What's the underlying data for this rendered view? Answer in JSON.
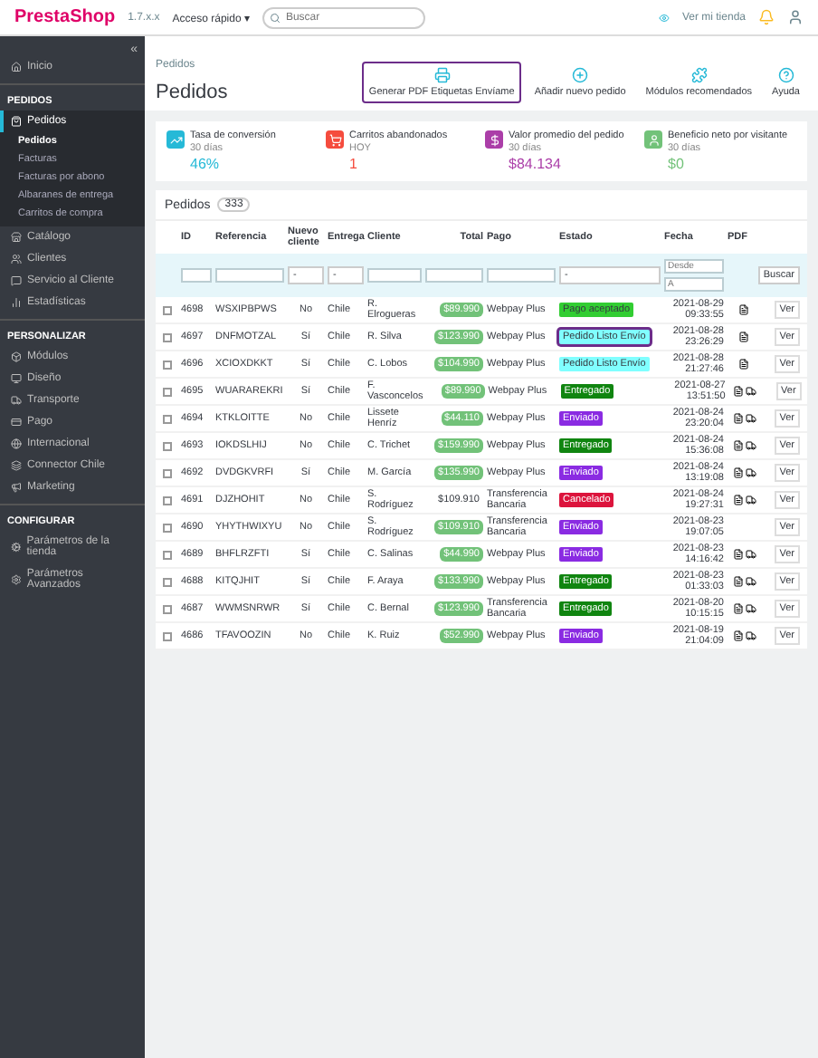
{
  "header": {
    "logo": "PrestaShop",
    "version": "1.7.x.x",
    "quick_access": "Acceso rápido ▾",
    "search": {
      "placeholder": "Buscar"
    },
    "store_link": "Ver mi tienda"
  },
  "sidebar": {
    "collapse": "«",
    "items": [
      {
        "label": "Inicio",
        "kind": "item",
        "selected": false
      },
      {
        "label": "PEDIDOS",
        "kind": "section"
      },
      {
        "label": "Pedidos",
        "kind": "item",
        "selected": true,
        "expanded": true,
        "children": [
          {
            "label": "Pedidos",
            "selected": true
          },
          {
            "label": "Facturas",
            "selected": false
          },
          {
            "label": "Facturas por abono",
            "selected": false
          },
          {
            "label": "Albaranes de entrega",
            "selected": false
          },
          {
            "label": "Carritos de compra",
            "selected": false
          }
        ]
      },
      {
        "label": "Catálogo",
        "kind": "item",
        "selected": false
      },
      {
        "label": "Clientes",
        "kind": "item",
        "selected": false
      },
      {
        "label": "Servicio al Cliente",
        "kind": "item",
        "selected": false
      },
      {
        "label": "Estadísticas",
        "kind": "item",
        "selected": false
      },
      {
        "label": "PERSONALIZAR",
        "kind": "section"
      },
      {
        "label": "Módulos",
        "kind": "item",
        "selected": false
      },
      {
        "label": "Diseño",
        "kind": "item",
        "selected": false
      },
      {
        "label": "Transporte",
        "kind": "item",
        "selected": false
      },
      {
        "label": "Pago",
        "kind": "item",
        "selected": false
      },
      {
        "label": "Internacional",
        "kind": "item",
        "selected": false
      },
      {
        "label": "Connector Chile",
        "kind": "item",
        "selected": false
      },
      {
        "label": "Marketing",
        "kind": "item",
        "selected": false
      },
      {
        "label": "CONFIGURAR",
        "kind": "section"
      },
      {
        "label": "Parámetros de la tienda",
        "kind": "item",
        "selected": false
      },
      {
        "label": "Parámetros Avanzados",
        "kind": "item",
        "selected": false
      }
    ]
  },
  "toolbar": {
    "breadcrumb": "Pedidos",
    "title": "Pedidos",
    "buttons": [
      {
        "label": "Generar PDF Etiquetas Envíame",
        "kind": "print",
        "highlighted": true
      },
      {
        "label": "Añadir nuevo pedido",
        "kind": "add",
        "highlighted": false
      },
      {
        "label": "Módulos recomendados",
        "kind": "puzzle",
        "highlighted": false
      },
      {
        "label": "Ayuda",
        "kind": "help",
        "highlighted": false
      }
    ]
  },
  "kpis": [
    {
      "title": "Tasa de conversión",
      "period": "30 días",
      "value": "46%",
      "kind": "conversion",
      "color": "#25b9d7"
    },
    {
      "title": "Carritos abandonados",
      "period": "HOY",
      "value": "1",
      "kind": "cart",
      "color": "#f54c3e"
    },
    {
      "title": "Valor promedio del pedido",
      "period": "30 días",
      "value": "$84.134",
      "kind": "money",
      "color": "#ab3ea8"
    },
    {
      "title": "Beneficio neto por visitante",
      "period": "30 días",
      "value": "$0",
      "kind": "user",
      "color": "#72c279"
    }
  ],
  "table": {
    "title": "Pedidos",
    "count": "333",
    "columns": [
      "ID",
      "Referencia",
      "Nuevo cliente",
      "Entrega",
      "Cliente",
      "Total",
      "Pago",
      "Estado",
      "Fecha",
      "PDF"
    ],
    "filters": {
      "date_from": {
        "placeholder": "Desde"
      },
      "date_to": {
        "placeholder": "A"
      },
      "search_button": "Buscar",
      "selects": [
        "-",
        "-",
        "-"
      ]
    },
    "rows": [
      {
        "id": "4698",
        "ref": "WSXIPBPWS",
        "new": "No",
        "delivery": "Chile",
        "customer": "R. Elrogueras",
        "total": "$89.990",
        "total_paid": true,
        "payment": "Webpay Plus",
        "status": "Pago aceptado",
        "color": "#32cd32",
        "selected": false,
        "date": "2021-08-29 09:33:55",
        "invoice": true,
        "delivery_slip": false,
        "checked": false,
        "view": "Ver"
      },
      {
        "id": "4697",
        "ref": "DNFMOTZAL",
        "new": "Sí",
        "delivery": "Chile",
        "customer": "R. Silva",
        "total": "$123.990",
        "total_paid": true,
        "payment": "Webpay Plus",
        "status": "Pedido Listo Envío",
        "color": "#80ffff",
        "selected": true,
        "date": "2021-08-28 23:26:29",
        "invoice": true,
        "delivery_slip": false,
        "checked": false,
        "view": "Ver"
      },
      {
        "id": "4696",
        "ref": "XCIOXDKKT",
        "new": "Sí",
        "delivery": "Chile",
        "customer": "C. Lobos",
        "total": "$104.990",
        "total_paid": true,
        "payment": "Webpay Plus",
        "status": "Pedido Listo Envío",
        "color": "#80ffff",
        "selected": false,
        "date": "2021-08-28 21:27:46",
        "invoice": true,
        "delivery_slip": false,
        "checked": false,
        "view": "Ver"
      },
      {
        "id": "4695",
        "ref": "WUARAREKRI",
        "new": "Sí",
        "delivery": "Chile",
        "customer": "F. Vasconcelos",
        "total": "$89.990",
        "total_paid": true,
        "payment": "Webpay Plus",
        "status": "Entregado",
        "color": "#108510",
        "selected": false,
        "date": "2021-08-27 13:51:50",
        "invoice": true,
        "delivery_slip": true,
        "checked": false,
        "view": "Ver"
      },
      {
        "id": "4694",
        "ref": "KTKLOITTE",
        "new": "No",
        "delivery": "Chile",
        "customer": "Lissete Henríz",
        "total": "$44.110",
        "total_paid": true,
        "payment": "Webpay Plus",
        "status": "Enviado",
        "color": "#8a2be2",
        "selected": false,
        "date": "2021-08-24 23:20:04",
        "invoice": true,
        "delivery_slip": true,
        "checked": false,
        "view": "Ver"
      },
      {
        "id": "4693",
        "ref": "IOKDSLHIJ",
        "new": "No",
        "delivery": "Chile",
        "customer": "C. Trichet",
        "total": "$159.990",
        "total_paid": true,
        "payment": "Webpay Plus",
        "status": "Entregado",
        "color": "#108510",
        "selected": false,
        "date": "2021-08-24 15:36:08",
        "invoice": true,
        "delivery_slip": true,
        "checked": false,
        "view": "Ver"
      },
      {
        "id": "4692",
        "ref": "DVDGKVRFI",
        "new": "Sí",
        "delivery": "Chile",
        "customer": "M. García",
        "total": "$135.990",
        "total_paid": true,
        "payment": "Webpay Plus",
        "status": "Enviado",
        "color": "#8a2be2",
        "selected": false,
        "date": "2021-08-24 13:19:08",
        "invoice": true,
        "delivery_slip": true,
        "checked": false,
        "view": "Ver"
      },
      {
        "id": "4691",
        "ref": "DJZHOHIT",
        "new": "No",
        "delivery": "Chile",
        "customer": "S. Rodríguez",
        "total": "$109.910",
        "total_paid": false,
        "payment": "Transferencia Bancaria",
        "status": "Cancelado",
        "color": "#dc143c",
        "selected": false,
        "date": "2021-08-24 19:27:31",
        "invoice": true,
        "delivery_slip": true,
        "checked": false,
        "view": "Ver"
      },
      {
        "id": "4690",
        "ref": "YHYTHWIXYU",
        "new": "No",
        "delivery": "Chile",
        "customer": "S. Rodríguez",
        "total": "$109.910",
        "total_paid": true,
        "payment": "Transferencia Bancaria",
        "status": "Enviado",
        "color": "#8a2be2",
        "selected": false,
        "date": "2021-08-23 19:07:05",
        "invoice": false,
        "delivery_slip": false,
        "checked": false,
        "view": "Ver"
      },
      {
        "id": "4689",
        "ref": "BHFLRZFTI",
        "new": "Sí",
        "delivery": "Chile",
        "customer": "C. Salinas",
        "total": "$44.990",
        "total_paid": true,
        "payment": "Webpay Plus",
        "status": "Enviado",
        "color": "#8a2be2",
        "selected": false,
        "date": "2021-08-23 14:16:42",
        "invoice": true,
        "delivery_slip": true,
        "checked": false,
        "view": "Ver"
      },
      {
        "id": "4688",
        "ref": "KITQJHIT",
        "new": "Sí",
        "delivery": "Chile",
        "customer": "F. Araya",
        "total": "$133.990",
        "total_paid": true,
        "payment": "Webpay Plus",
        "status": "Entregado",
        "color": "#108510",
        "selected": false,
        "date": "2021-08-23 01:33:03",
        "invoice": true,
        "delivery_slip": true,
        "checked": false,
        "view": "Ver"
      },
      {
        "id": "4687",
        "ref": "WWMSNRWR",
        "new": "Sí",
        "delivery": "Chile",
        "customer": "C. Bernal",
        "total": "$123.990",
        "total_paid": true,
        "payment": "Transferencia Bancaria",
        "status": "Entregado",
        "color": "#108510",
        "selected": false,
        "date": "2021-08-20 10:15:15",
        "invoice": true,
        "delivery_slip": true,
        "checked": false,
        "view": "Ver"
      },
      {
        "id": "4686",
        "ref": "TFAVOOZIN",
        "new": "No",
        "delivery": "Chile",
        "customer": "K. Ruiz",
        "total": "$52.990",
        "total_paid": true,
        "payment": "Webpay Plus",
        "status": "Enviado",
        "color": "#8a2be2",
        "selected": false,
        "date": "2021-08-19 21:04:09",
        "invoice": true,
        "delivery_slip": true,
        "checked": false,
        "view": "Ver"
      }
    ]
  }
}
